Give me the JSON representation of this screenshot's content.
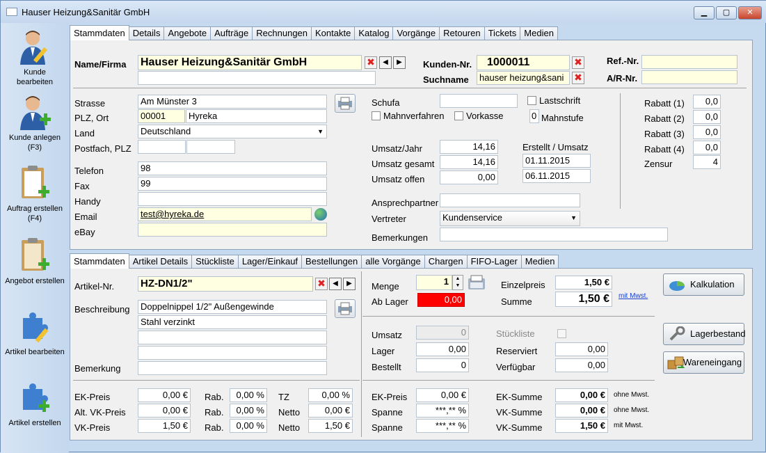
{
  "window": {
    "title": "Hauser Heizung&Sanitär GmbH"
  },
  "sidebar": {
    "items": [
      {
        "label": "Kunde bearbeiten",
        "icon": "user-edit-icon"
      },
      {
        "label": "Kunde anlegen (F3)",
        "icon": "user-add-icon"
      },
      {
        "label": "Auftrag erstellen (F4)",
        "icon": "clipboard-add-icon"
      },
      {
        "label": "Angebot erstellen",
        "icon": "clipboard-add-icon"
      },
      {
        "label": "Artikel bearbeiten",
        "icon": "puzzle-edit-icon"
      },
      {
        "label": "Artikel erstellen",
        "icon": "puzzle-add-icon"
      }
    ]
  },
  "top_tabs": [
    "Stammdaten",
    "Details",
    "Angebote",
    "Aufträge",
    "Rechnungen",
    "Kontakte",
    "Katalog",
    "Vorgänge",
    "Retouren",
    "Tickets",
    "Medien"
  ],
  "customer": {
    "name_label": "Name/Firma",
    "name": "Hauser Heizung&Sanitär GmbH",
    "name2": "",
    "kunden_nr_label": "Kunden-Nr.",
    "kunden_nr": "1000011",
    "suchname_label": "Suchname",
    "suchname": "hauser heizung&sani",
    "ref_label": "Ref.-Nr.",
    "ar_label": "A/R-Nr.",
    "strasse_label": "Strasse",
    "strasse": "Am Münster 3",
    "plz_label": "PLZ, Ort",
    "plz": "00001",
    "ort": "Hyreka",
    "land_label": "Land",
    "land": "Deutschland",
    "postfach_label": "Postfach, PLZ",
    "telefon_label": "Telefon",
    "telefon": "98",
    "fax_label": "Fax",
    "fax": "99",
    "handy_label": "Handy",
    "email_label": "Email",
    "email": "test@hyreka.de",
    "ebay_label": "eBay",
    "schufa_label": "Schufa",
    "lastschrift_label": "Lastschrift",
    "mahnverfahren_label": "Mahnverfahren",
    "vorkasse_label": "Vorkasse",
    "mahnstufe_label": "Mahnstufe",
    "mahnstufe": "0",
    "umsatz_jahr_label": "Umsatz/Jahr",
    "umsatz_jahr": "14,16",
    "umsatz_gesamt_label": "Umsatz gesamt",
    "umsatz_gesamt": "14,16",
    "umsatz_offen_label": "Umsatz offen",
    "umsatz_offen": "0,00",
    "erstellt_label": "Erstellt / Umsatz",
    "erstellt": "01.11.2015",
    "umsatz_datum": "06.11.2015",
    "ansprechpartner_label": "Ansprechpartner",
    "vertreter_label": "Vertreter",
    "vertreter": "Kundenservice",
    "bemerkungen_label": "Bemerkungen",
    "rabatt1_label": "Rabatt (1)",
    "rabatt1": "0,0",
    "rabatt2_label": "Rabatt (2)",
    "rabatt2": "0,0",
    "rabatt3_label": "Rabatt (3)",
    "rabatt3": "0,0",
    "rabatt4_label": "Rabatt (4)",
    "rabatt4": "0,0",
    "zensur_label": "Zensur",
    "zensur": "4"
  },
  "article_tabs": [
    "Stammdaten",
    "Artikel Details",
    "Stückliste",
    "Lager/Einkauf",
    "Bestellungen",
    "alle Vorgänge",
    "Chargen",
    "FIFO-Lager",
    "Medien"
  ],
  "article": {
    "artikel_nr_label": "Artikel-Nr.",
    "artikel_nr": "HZ-DN1/2\"",
    "beschreibung_label": "Beschreibung",
    "beschreibung1": "Doppelnippel 1/2\" Außengewinde",
    "beschreibung2": "Stahl verzinkt",
    "bemerkung_label": "Bemerkung",
    "menge_label": "Menge",
    "menge": "1",
    "ab_lager_label": "Ab Lager",
    "ab_lager": "0,00",
    "einzelpreis_label": "Einzelpreis",
    "einzelpreis": "1,50 €",
    "summe_label": "Summe",
    "summe": "1,50  €",
    "mit_mwst_link": "mit Mwst.",
    "kalkulation_label": "Kalkulation",
    "lagerbestand_label": "Lagerbestand",
    "wareneingang_label": "Wareneingang",
    "umsatz_label": "Umsatz",
    "umsatz": "0",
    "lager_label": "Lager",
    "lager": "0,00",
    "bestellt_label": "Bestellt",
    "bestellt": "0",
    "stueckliste_label": "Stückliste",
    "reserviert_label": "Reserviert",
    "reserviert": "0,00",
    "verfuegbar_label": "Verfügbar",
    "verfuegbar": "0,00",
    "ek_preis_label": "EK-Preis",
    "ek_preis": "0,00  €",
    "alt_vk_label": "Alt. VK-Preis",
    "alt_vk": "0,00  €",
    "vk_preis_label": "VK-Preis",
    "vk_preis": "1,50  €",
    "rab_label": "Rab.",
    "rab1": "0,00 %",
    "rab2": "0,00 %",
    "rab3": "0,00 %",
    "tz_label": "TZ",
    "tz": "0,00 %",
    "netto_label": "Netto",
    "netto1": "0,00  €",
    "netto2": "1,50  €",
    "ek_preis2_label": "EK-Preis",
    "ek_preis2": "0,00  €",
    "spanne_label": "Spanne",
    "spanne1": "***,** %",
    "spanne2": "***,** %",
    "ek_summe_label": "EK-Summe",
    "ek_summe": "0,00  €",
    "vk_summe_label": "VK-Summe",
    "vk_summe1": "0,00  €",
    "vk_summe2": "1,50  €",
    "ohne_mwst": "ohne Mwst.",
    "mit_mwst": "mit Mwst."
  }
}
